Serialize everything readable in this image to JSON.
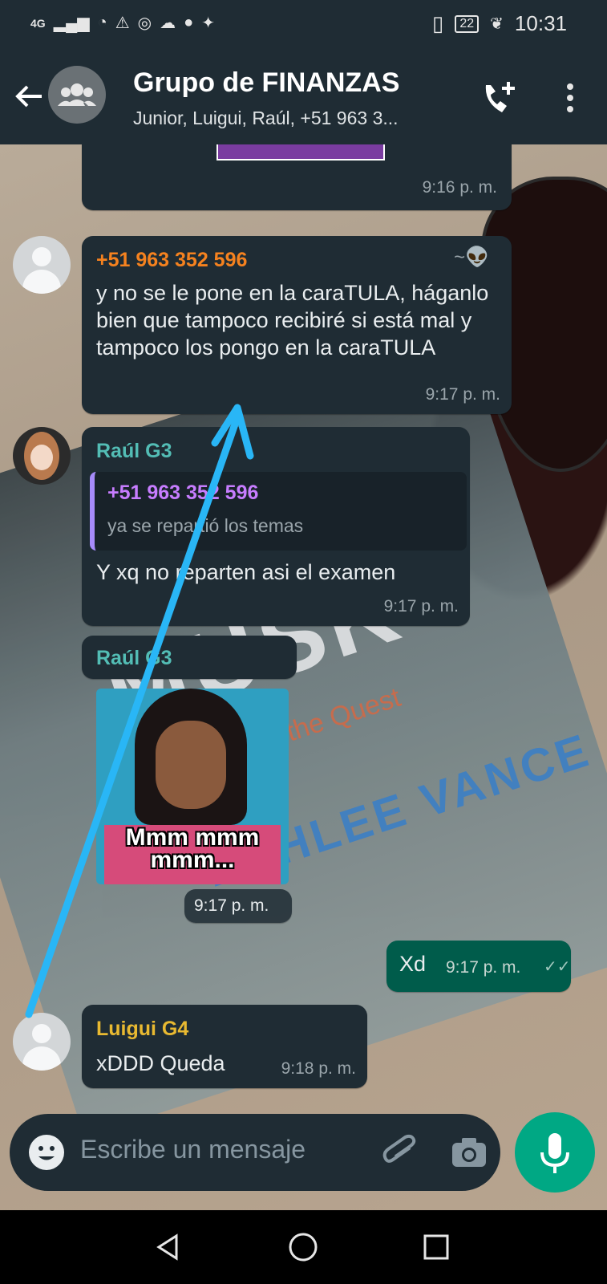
{
  "status_bar": {
    "network": "4G",
    "battery": "22",
    "time": "10:31"
  },
  "header": {
    "title": "Grupo de FINANZAS",
    "subtitle": "Junior, Luigui, Raúl, +51 963 3..."
  },
  "messages": [
    {
      "time": "9:16 p. m."
    },
    {
      "sender": "+51 963 352 596",
      "sender_color": "#f5821f",
      "extra": "~👽",
      "text": "y no se le pone en la caraTULA, háganlo bien que tampoco recibiré si está mal y tampoco los pongo en la caraTULA",
      "time": "9:17 p. m."
    },
    {
      "sender": "Raúl G3",
      "sender_color": "#53bdb5",
      "quote_sender": "+51 963 352 596",
      "quote_text": "ya se repartió los temas",
      "text": "Y xq no reparten asi el examen",
      "time": "9:17 p. m."
    },
    {
      "sender": "Raúl G3",
      "sticker_caption": "Mmm mmm mmm...",
      "time": "9:17 p. m."
    },
    {
      "text": "Xd",
      "time": "9:17 p. m."
    },
    {
      "sender": "Luigui G4",
      "sender_color": "#e8b931",
      "text": "xDDD Queda",
      "time": "9:18 p. m."
    }
  ],
  "background": {
    "book_title": "MUSK",
    "book_author": "ASHLEE VANCE",
    "book_sub": "and the Quest"
  },
  "composer": {
    "placeholder": "Escribe un mensaje"
  },
  "colors": {
    "header": "#1f2c34",
    "incoming": "#1f2c34",
    "outgoing": "#005c4b",
    "mic": "#00a884",
    "annotation_arrow": "#29b6f6"
  }
}
